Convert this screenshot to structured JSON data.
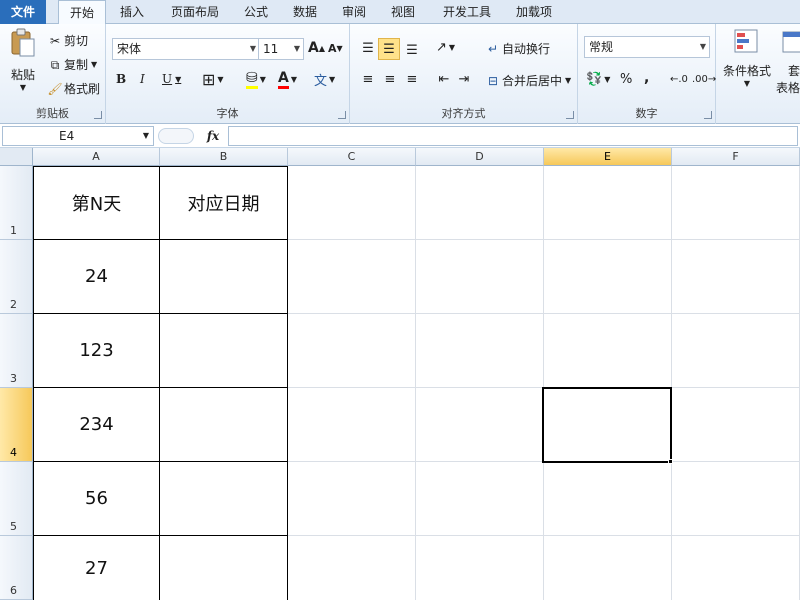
{
  "tabs": {
    "file": "文件",
    "home": "开始",
    "insert": "插入",
    "page_layout": "页面布局",
    "formulas": "公式",
    "data": "数据",
    "review": "审阅",
    "view": "视图",
    "developer": "开发工具",
    "addins": "加载项"
  },
  "clipboard": {
    "paste": "粘贴",
    "cut": "剪切",
    "copy": "复制",
    "format_painter": "格式刷",
    "label": "剪贴板"
  },
  "font": {
    "name": "宋体",
    "size": "11",
    "grow": "A",
    "shrink": "A",
    "bold": "B",
    "italic": "I",
    "underline": "U",
    "font_color_glyph": "A",
    "label": "字体"
  },
  "alignment": {
    "wrap_text": "自动换行",
    "merge_center": "合并后居中",
    "label": "对齐方式"
  },
  "number": {
    "format": "常规",
    "percent": "%",
    "comma": ",",
    "label": "数字"
  },
  "styles": {
    "conditional_format": "条件格式",
    "table_format_line1": "套",
    "table_format_line2": "表格格"
  },
  "formula_bar": {
    "name_box": "E4",
    "fx": "fx",
    "content": ""
  },
  "sheet": {
    "columns": [
      "A",
      "B",
      "C",
      "D",
      "E",
      "F"
    ],
    "active_column": "E",
    "rows": [
      "1",
      "2",
      "3",
      "4",
      "5",
      "6"
    ],
    "active_row": "4",
    "header_a": "第N天",
    "header_b": "对应日期",
    "values_a": [
      "24",
      "123",
      "234",
      "56",
      "27"
    ],
    "values_b": [
      "",
      "",
      "",
      "",
      ""
    ]
  }
}
